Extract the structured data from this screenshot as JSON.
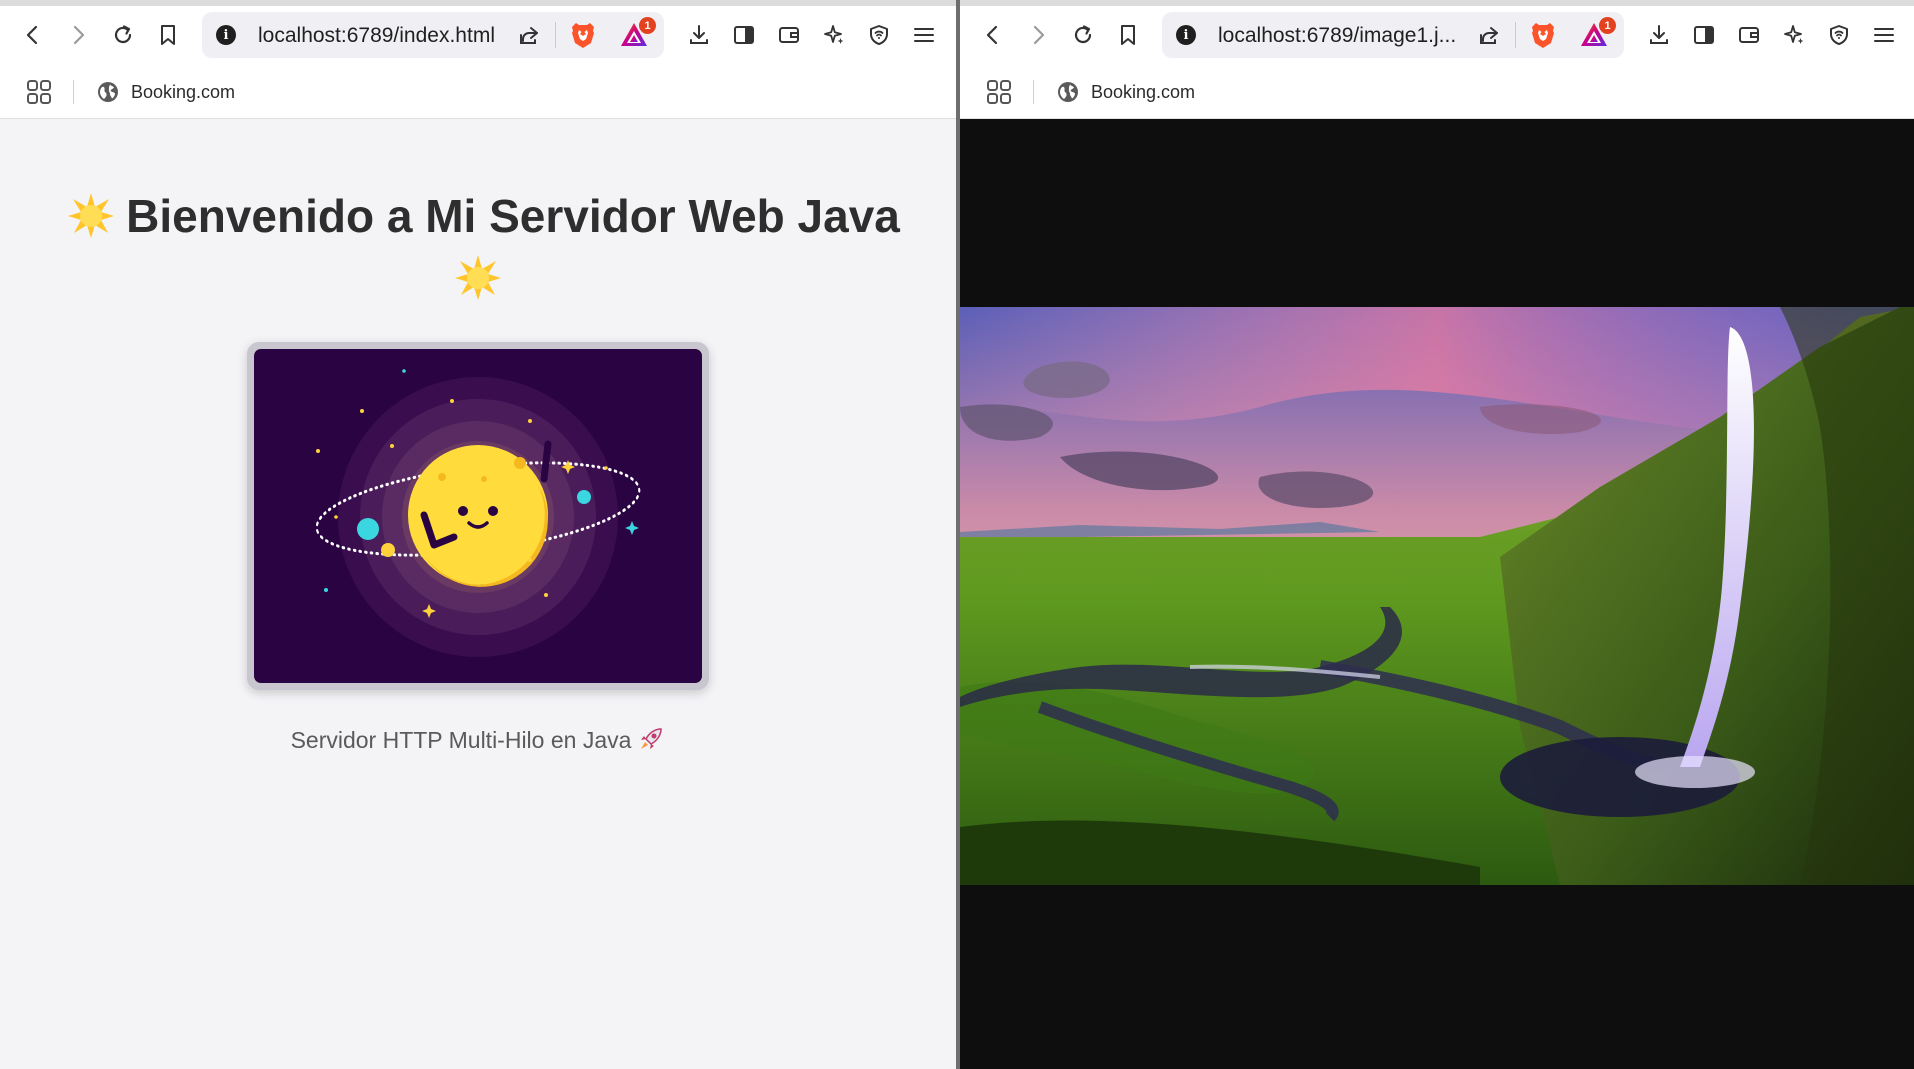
{
  "left_window": {
    "url": "localhost:6789/index.html",
    "rewards_badge": "1",
    "bookmark_label": "Booking.com",
    "page": {
      "heading": "Bienvenido a Mi Servidor Web Java",
      "caption": "Servidor HTTP Multi-Hilo en Java"
    }
  },
  "right_window": {
    "url": "localhost:6789/image1.j...",
    "rewards_badge": "1",
    "bookmark_label": "Booking.com"
  },
  "colors": {
    "brave_orange": "#fb542b",
    "badge_red": "#e3421f",
    "image_bg": "#2a0342",
    "sun_yellow": "#ffdb3b"
  },
  "icons": [
    "back-icon",
    "forward-icon",
    "reload-icon",
    "bookmark-icon",
    "info-icon",
    "share-icon",
    "brave-shield-icon",
    "brave-rewards-icon",
    "download-icon",
    "sidebar-icon",
    "wallet-icon",
    "leo-ai-icon",
    "vpn-icon",
    "menu-icon",
    "apps-grid-icon",
    "globe-icon",
    "star-emoji",
    "rocket-emoji"
  ]
}
